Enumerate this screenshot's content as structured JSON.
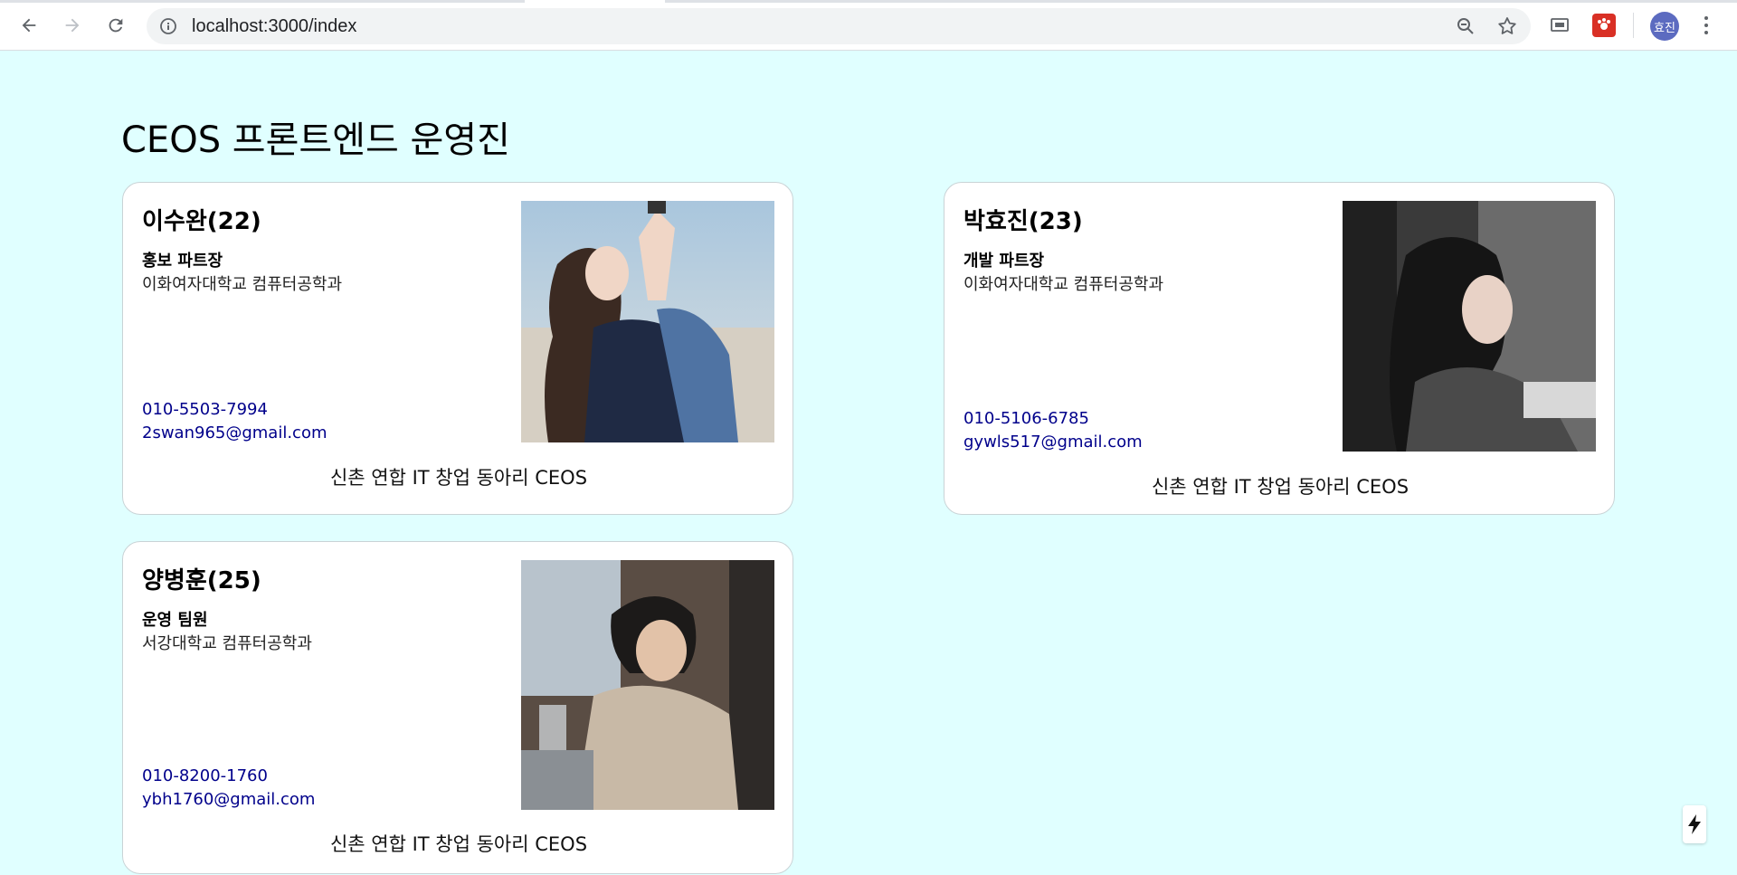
{
  "browser": {
    "url": "localhost:3000/index",
    "profile_initials": "효진"
  },
  "page": {
    "title": "CEOS 프론트엔드 운영진"
  },
  "members": [
    {
      "name": "이수완(22)",
      "role": "홍보 파트장",
      "school": "이화여자대학교 컴퓨터공학과",
      "phone": "010-5503-7994",
      "email": "2swan965@gmail.com",
      "footer": "신촌 연합 IT 창업 동아리 CEOS"
    },
    {
      "name": "박효진(23)",
      "role": "개발 파트장",
      "school": "이화여자대학교 컴퓨터공학과",
      "phone": "010-5106-6785",
      "email": "gywls517@gmail.com",
      "footer": "신촌 연합 IT 창업 동아리 CEOS"
    },
    {
      "name": "양병훈(25)",
      "role": "운영 팀원",
      "school": "서강대학교 컴퓨터공학과",
      "phone": "010-8200-1760",
      "email": "ybh1760@gmail.com",
      "footer": "신촌 연합 IT 창업 동아리 CEOS"
    }
  ],
  "colors": {
    "page_background": "#e0ffff",
    "link": "#00008b",
    "avatar": "#5c6bc0"
  },
  "icons": [
    "back-arrow-icon",
    "forward-arrow-icon",
    "reload-icon",
    "info-icon",
    "zoom-icon",
    "star-icon",
    "cast-icon",
    "extension-icon",
    "kebab-menu-icon",
    "lightning-icon"
  ]
}
